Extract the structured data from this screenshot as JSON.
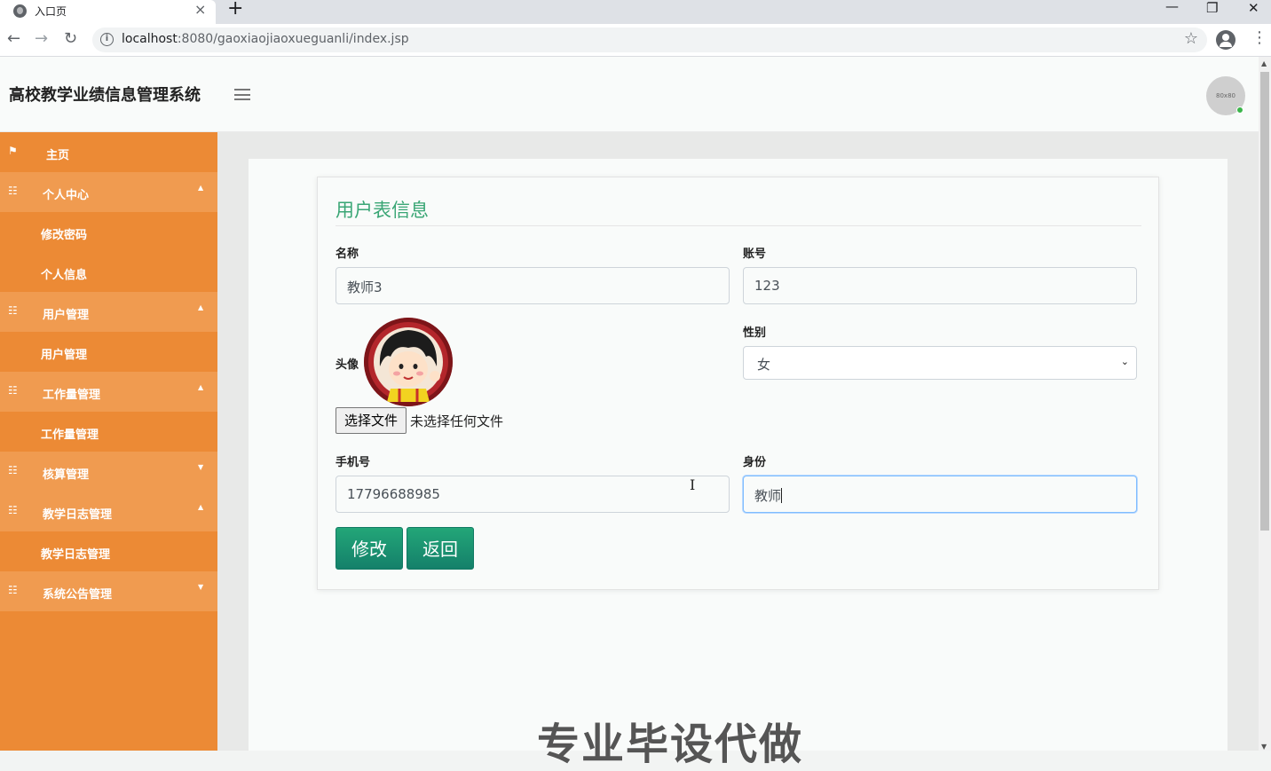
{
  "browser": {
    "tab_title": "入口页",
    "tab_close": "×",
    "new_tab": "+",
    "url_host": "localhost",
    "url_path": ":8080/gaoxiaojiaoxueguanli/index.jsp",
    "back_icon": "←",
    "forward_icon": "→",
    "reload_icon": "↻",
    "info_icon": "i",
    "star_icon": "☆",
    "kebab_icon": "⋮",
    "minimize_icon": "—",
    "restore_icon": "❐",
    "close_icon": "✕"
  },
  "header": {
    "title": "高校教学业绩信息管理系统",
    "avatar_text": "80x80"
  },
  "sidebar": {
    "items": [
      {
        "label": "主页",
        "type": "top",
        "icon": "flag-icon"
      },
      {
        "label": "个人中心",
        "type": "group",
        "icon": "grid-icon",
        "caret": "▲"
      },
      {
        "label": "修改密码",
        "type": "sub"
      },
      {
        "label": "个人信息",
        "type": "sub"
      },
      {
        "label": "用户管理",
        "type": "group",
        "icon": "grid-icon",
        "caret": "▲"
      },
      {
        "label": "用户管理",
        "type": "sub"
      },
      {
        "label": "工作量管理",
        "type": "group",
        "icon": "grid-icon",
        "caret": "▲"
      },
      {
        "label": "工作量管理",
        "type": "sub"
      },
      {
        "label": "核算管理",
        "type": "group",
        "icon": "grid-icon",
        "caret": "▼"
      },
      {
        "label": "教学日志管理",
        "type": "group",
        "icon": "grid-icon",
        "caret": "▲"
      },
      {
        "label": "教学日志管理",
        "type": "sub"
      },
      {
        "label": "系统公告管理",
        "type": "group",
        "icon": "grid-icon",
        "caret": "▼"
      }
    ]
  },
  "form": {
    "title": "用户表信息",
    "name_label": "名称",
    "name_value": "教师3",
    "account_label": "账号",
    "account_value": "123",
    "avatar_label": "头像",
    "file_button": "选择文件",
    "file_status": "未选择任何文件",
    "gender_label": "性别",
    "gender_value": "女",
    "phone_label": "手机号",
    "phone_value": "17796688985",
    "role_label": "身份",
    "role_value": "教师",
    "submit_button": "修改",
    "back_button": "返回"
  },
  "watermark": "专业毕设代做",
  "colors": {
    "sidebar": "#ec8a35",
    "sidebar_group": "#f09b50",
    "accent_green": "#3aa675",
    "button": "#1b9470"
  }
}
